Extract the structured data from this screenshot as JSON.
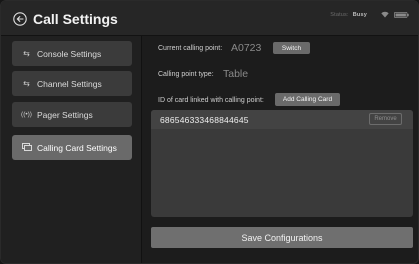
{
  "header": {
    "title": "Call Settings",
    "status_label": "Status:",
    "status_value": "Busy"
  },
  "sidebar": {
    "items": [
      {
        "label": "Console Settings",
        "icon": "swap-arrows-icon"
      },
      {
        "label": "Channel Settings",
        "icon": "swap-arrows-icon"
      },
      {
        "label": "Pager Settings",
        "icon": "broadcast-icon"
      },
      {
        "label": "Calling Card Settings",
        "icon": "card-icon",
        "active": true
      }
    ]
  },
  "main": {
    "current_point_label": "Current calling point:",
    "current_point_value": "A0723",
    "switch_label": "Switch",
    "point_type_label": "Calling point type:",
    "point_type_value": "Table",
    "linked_card_label": "ID of card linked with calling point:",
    "add_card_label": "Add Calling Card",
    "cards": [
      {
        "id": "686546333468844645",
        "remove_label": "Remove"
      }
    ],
    "save_label": "Save Configurations"
  },
  "colors": {
    "background": "#1c1c1c",
    "sidebar_item": "#3b3b3b",
    "sidebar_item_active": "#6a6a6a",
    "button": "#6a6a6a"
  }
}
